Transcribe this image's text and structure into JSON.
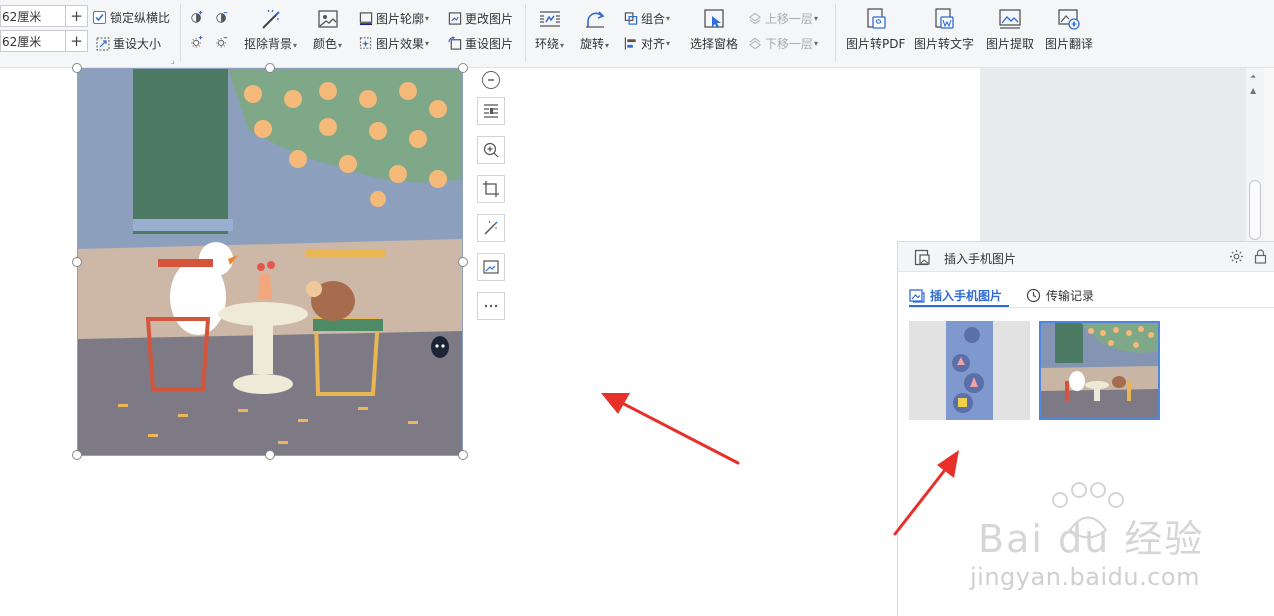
{
  "ribbon": {
    "height_value": "62厘米",
    "width_value": "62厘米",
    "lock_ratio_label": "锁定纵横比",
    "reset_size_label": "重设大小",
    "remove_bg_label": "抠除背景",
    "color_label": "颜色",
    "outline_label": "图片轮廓",
    "effect_label": "图片效果",
    "change_pic_label": "更改图片",
    "reset_pic_label": "重设图片",
    "wrap_label": "环绕",
    "rotate_label": "旋转",
    "group_label": "组合",
    "align_label": "对齐",
    "selection_pane_label": "选择窗格",
    "bring_forward_label": "上移一层",
    "send_backward_label": "下移一层",
    "pic_to_pdf_label": "图片转PDF",
    "pic_to_text_label": "图片转文字",
    "pic_extract_label": "图片提取",
    "pic_translate_label": "图片翻译"
  },
  "panel": {
    "title": "插入手机图片",
    "tabs": [
      {
        "label": "插入手机图片",
        "active": true
      },
      {
        "label": "传输记录",
        "active": false
      }
    ]
  },
  "watermark": {
    "brand": "Bai du 经验",
    "url": "jingyan.baidu.com"
  },
  "colors": {
    "accent": "#2f6bd2",
    "arrow": "#e8302b"
  }
}
